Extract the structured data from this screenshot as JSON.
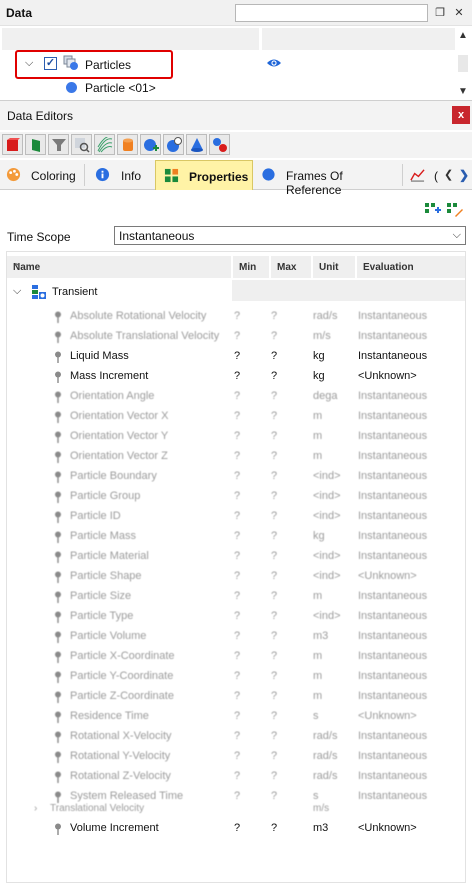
{
  "data_panel": {
    "title": "Data",
    "tree": {
      "group_label": "Particles",
      "child_label": "Particle <01>"
    }
  },
  "editor": {
    "title": "Data Editors",
    "close_label": "x",
    "tabs": [
      {
        "label": "Coloring"
      },
      {
        "label": "Info"
      },
      {
        "label": "Properties"
      },
      {
        "label": "Frames Of Reference"
      },
      {
        "label": "("
      }
    ],
    "time_scope_label": "Time Scope",
    "time_scope_value": "Instantaneous",
    "columns": {
      "name": "Name",
      "min": "Min",
      "max": "Max",
      "unit": "Unit",
      "evaluation": "Evaluation"
    },
    "group_label": "Transient",
    "rows": [
      {
        "name": "Absolute Rotational Velocity",
        "min": "?",
        "max": "?",
        "unit": "rad/s",
        "eval": "Instantaneous",
        "dim": true
      },
      {
        "name": "Absolute Translational Velocity",
        "min": "?",
        "max": "?",
        "unit": "m/s",
        "eval": "Instantaneous",
        "dim": true
      },
      {
        "name": "Liquid Mass",
        "min": "?",
        "max": "?",
        "unit": "kg",
        "eval": "Instantaneous",
        "dim": false
      },
      {
        "name": "Mass Increment",
        "min": "?",
        "max": "?",
        "unit": "kg",
        "eval": "<Unknown>",
        "dim": false
      },
      {
        "name": "Orientation Angle",
        "min": "?",
        "max": "?",
        "unit": "dega",
        "eval": "Instantaneous",
        "dim": true
      },
      {
        "name": "Orientation Vector X",
        "min": "?",
        "max": "?",
        "unit": "m",
        "eval": "Instantaneous",
        "dim": true
      },
      {
        "name": "Orientation Vector Y",
        "min": "?",
        "max": "?",
        "unit": "m",
        "eval": "Instantaneous",
        "dim": true
      },
      {
        "name": "Orientation Vector Z",
        "min": "?",
        "max": "?",
        "unit": "m",
        "eval": "Instantaneous",
        "dim": true
      },
      {
        "name": "Particle Boundary",
        "min": "?",
        "max": "?",
        "unit": "<ind>",
        "eval": "Instantaneous",
        "dim": true
      },
      {
        "name": "Particle Group",
        "min": "?",
        "max": "?",
        "unit": "<ind>",
        "eval": "Instantaneous",
        "dim": true
      },
      {
        "name": "Particle ID",
        "min": "?",
        "max": "?",
        "unit": "<ind>",
        "eval": "Instantaneous",
        "dim": true
      },
      {
        "name": "Particle Mass",
        "min": "?",
        "max": "?",
        "unit": "kg",
        "eval": "Instantaneous",
        "dim": true
      },
      {
        "name": "Particle Material",
        "min": "?",
        "max": "?",
        "unit": "<ind>",
        "eval": "Instantaneous",
        "dim": true
      },
      {
        "name": "Particle Shape",
        "min": "?",
        "max": "?",
        "unit": "<ind>",
        "eval": "<Unknown>",
        "dim": true
      },
      {
        "name": "Particle Size",
        "min": "?",
        "max": "?",
        "unit": "m",
        "eval": "Instantaneous",
        "dim": true
      },
      {
        "name": "Particle Type",
        "min": "?",
        "max": "?",
        "unit": "<ind>",
        "eval": "Instantaneous",
        "dim": true
      },
      {
        "name": "Particle Volume",
        "min": "?",
        "max": "?",
        "unit": "m3",
        "eval": "Instantaneous",
        "dim": true
      },
      {
        "name": "Particle X-Coordinate",
        "min": "?",
        "max": "?",
        "unit": "m",
        "eval": "Instantaneous",
        "dim": true
      },
      {
        "name": "Particle Y-Coordinate",
        "min": "?",
        "max": "?",
        "unit": "m",
        "eval": "Instantaneous",
        "dim": true
      },
      {
        "name": "Particle Z-Coordinate",
        "min": "?",
        "max": "?",
        "unit": "m",
        "eval": "Instantaneous",
        "dim": true
      },
      {
        "name": "Residence Time",
        "min": "?",
        "max": "?",
        "unit": "s",
        "eval": "<Unknown>",
        "dim": true
      },
      {
        "name": "Rotational X-Velocity",
        "min": "?",
        "max": "?",
        "unit": "rad/s",
        "eval": "Instantaneous",
        "dim": true
      },
      {
        "name": "Rotational Y-Velocity",
        "min": "?",
        "max": "?",
        "unit": "rad/s",
        "eval": "Instantaneous",
        "dim": true
      },
      {
        "name": "Rotational Z-Velocity",
        "min": "?",
        "max": "?",
        "unit": "rad/s",
        "eval": "Instantaneous",
        "dim": true
      },
      {
        "name": "System Released Time",
        "min": "?",
        "max": "?",
        "unit": "s",
        "eval": "Instantaneous",
        "dim": true
      }
    ],
    "subgroup": {
      "name": "Translational Velocity",
      "unit": "m/s"
    },
    "last_row": {
      "name": "Volume Increment",
      "min": "?",
      "max": "?",
      "unit": "m3",
      "eval": "<Unknown>"
    }
  },
  "colors": {
    "accent": "#2a5db0",
    "highlight_box": "#e00000",
    "active_tab": "#fff3a6",
    "close": "#c8262d"
  }
}
